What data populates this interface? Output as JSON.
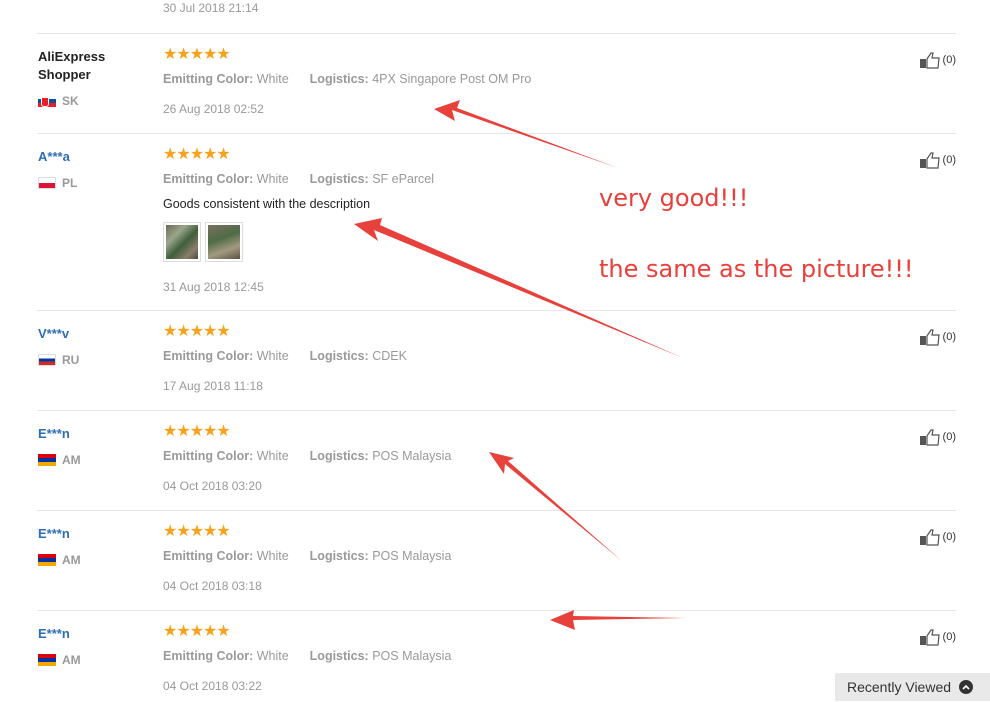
{
  "top_date": "30 Jul 2018 21:14",
  "labels": {
    "emitting_color": "Emitting Color:",
    "logistics": "Logistics:"
  },
  "feedbacks": [
    {
      "user": "AliExpress Shopper",
      "country": "SK",
      "flag": "sk",
      "stars": "★★★★★",
      "color": "White",
      "logistics": "4PX Singapore Post OM Pro",
      "text": "",
      "date": "26 Aug 2018 02:52",
      "useful": "(0)"
    },
    {
      "user": "A***a",
      "country": "PL",
      "flag": "pl",
      "stars": "★★★★★",
      "color": "White",
      "logistics": "SF eParcel",
      "text": "Goods consistent with the description",
      "date": "31 Aug 2018 12:45",
      "useful": "(0)"
    },
    {
      "user": "V***v",
      "country": "RU",
      "flag": "ru",
      "stars": "★★★★★",
      "color": "White",
      "logistics": "CDEK",
      "text": "",
      "date": "17 Aug 2018 11:18",
      "useful": "(0)"
    },
    {
      "user": "E***n",
      "country": "AM",
      "flag": "am",
      "stars": "★★★★★",
      "color": "White",
      "logistics": "POS Malaysia",
      "text": "",
      "date": "04 Oct 2018 03:20",
      "useful": "(0)"
    },
    {
      "user": "E***n",
      "country": "AM",
      "flag": "am",
      "stars": "★★★★★",
      "color": "White",
      "logistics": "POS Malaysia",
      "text": "",
      "date": "04 Oct 2018 03:18",
      "useful": "(0)"
    },
    {
      "user": "E***n",
      "country": "AM",
      "flag": "am",
      "stars": "★★★★★",
      "color": "White",
      "logistics": "POS Malaysia",
      "text": "",
      "date": "04 Oct 2018 03:22",
      "useful": "(0)"
    }
  ],
  "annotations": {
    "line1": "very good!!!",
    "line2": "the same as the picture!!!"
  },
  "recently_viewed": "Recently Viewed",
  "colors": {
    "star": "#f7a21c",
    "username": "#2d6fb5",
    "annotation": "#e8403a"
  }
}
